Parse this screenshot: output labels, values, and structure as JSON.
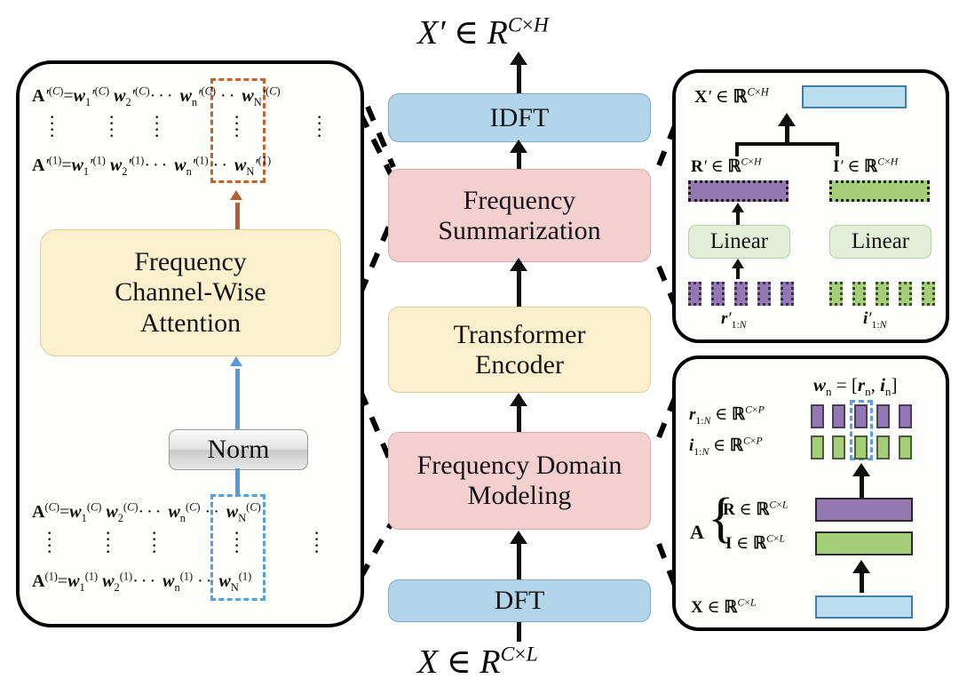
{
  "figure": {
    "type": "architecture-diagram",
    "title_top": "X' ∈ R^{C×H}",
    "title_bottom": "X ∈ R^{C×L}"
  },
  "io_labels": {
    "output": {
      "sym": "X",
      "prime": "′",
      "rel": "∈",
      "space": "R",
      "exp": "C×H"
    },
    "input": {
      "sym": "X",
      "prime": "",
      "rel": "∈",
      "space": "R",
      "exp": "C×L"
    }
  },
  "pipeline": {
    "blocks": [
      {
        "id": "idft",
        "label": "IDFT",
        "color": "#b3d5ea",
        "kind": "blue"
      },
      {
        "id": "frequency-summarization",
        "label_line1": "Frequency",
        "label_line2": "Summarization",
        "color": "#f3cfd0",
        "kind": "pink"
      },
      {
        "id": "transformer-encoder",
        "label_line1": "Transformer",
        "label_line2": "Encoder",
        "color": "#faf0cd",
        "kind": "yellow"
      },
      {
        "id": "frequency-domain-modeling",
        "label_line1": "Frequency Domain",
        "label_line2": "Modeling",
        "color": "#f3cfd0",
        "kind": "pink"
      },
      {
        "id": "dft",
        "label": "DFT",
        "color": "#b3d5ea",
        "kind": "blue"
      }
    ]
  },
  "left_panel": {
    "name": "frequency-channel-wise-attention-detail",
    "attention_block": {
      "line1": "Frequency",
      "line2": "Channel-Wise",
      "line3": "Attention",
      "color": "#faf0cd"
    },
    "norm_block": {
      "label": "Norm"
    },
    "output_matrix": {
      "highlight_color": "#c2632c",
      "row_top": {
        "lhs": "A′(C)",
        "eq": "=",
        "items": [
          "w′₁(C)",
          "w′₂(C)",
          "· · ·",
          "w′ₙ(C)",
          "· · ·",
          "w′_N(C)"
        ]
      },
      "row_bot": {
        "lhs": "A′(1)",
        "eq": "=",
        "items": [
          "w′₁(1)",
          "w′₂(1)",
          "· · ·",
          "w′ₙ(1)",
          "· · ·",
          "w′_N(1)"
        ]
      }
    },
    "input_matrix": {
      "highlight_color": "#55a0dd",
      "row_top": {
        "lhs": "A(C)",
        "eq": "=",
        "items": [
          "w₁(C)",
          "w₂(C)",
          "· · ·",
          "wₙ(C)",
          "· · ·",
          "w_N(C)"
        ]
      },
      "row_bot": {
        "lhs": "A(1)",
        "eq": "=",
        "items": [
          "w₁(1)",
          "w₂(1)",
          "· · ·",
          "wₙ(1)",
          "· · ·",
          "w_N(1)"
        ]
      }
    },
    "arrow_up_color": "#b5602e",
    "arrow_in_color": "#5599d6"
  },
  "top_right_panel": {
    "name": "frequency-summarization-detail",
    "output": {
      "label": "X′ ∈ ℝ^{C×H}",
      "bar_color": "#bcdcf0"
    },
    "real": {
      "label": "R′ ∈ ℝ^{C×H}",
      "bar_color": "#9478b4",
      "linear_label": "Linear",
      "seq_label": "r′_{1:N}",
      "chips": 5
    },
    "imag": {
      "label": "I′ ∈ ℝ^{C×H}",
      "bar_color": "#a5ce78",
      "linear_label": "Linear",
      "seq_label": "i′_{1:N}",
      "chips": 5
    }
  },
  "bottom_right_panel": {
    "name": "frequency-domain-modeling-detail",
    "token_def": "wₙ = [rₙ, iₙ]",
    "r_row": {
      "label": "r_{1:N} ∈ ℝ^{C×P}",
      "chips": 5,
      "color": "#9478b4"
    },
    "i_row": {
      "label": "i_{1:N} ∈ ℝ^{C×P}",
      "chips": 5,
      "color": "#a5ce78"
    },
    "highlight_color": "#55a0dd",
    "brace_label": "A",
    "R": {
      "label": "R ∈ ℝ^{C×L}",
      "color": "#9478b4"
    },
    "I": {
      "label": "I ∈ ℝ^{C×L}",
      "color": "#a5ce78"
    },
    "X": {
      "label": "X ∈ ℝ^{C×L}",
      "color": "#bcdcf0"
    }
  },
  "colors": {
    "blue_block": "#b3d5ea",
    "pink_block": "#f3cfd0",
    "yellow_block": "#faf0cd",
    "purple": "#9478b4",
    "green": "#a5ce78",
    "orange_accent": "#b5602e",
    "blue_accent": "#5599d6",
    "linear_green": "#e2eed8",
    "outline": "#000000"
  }
}
